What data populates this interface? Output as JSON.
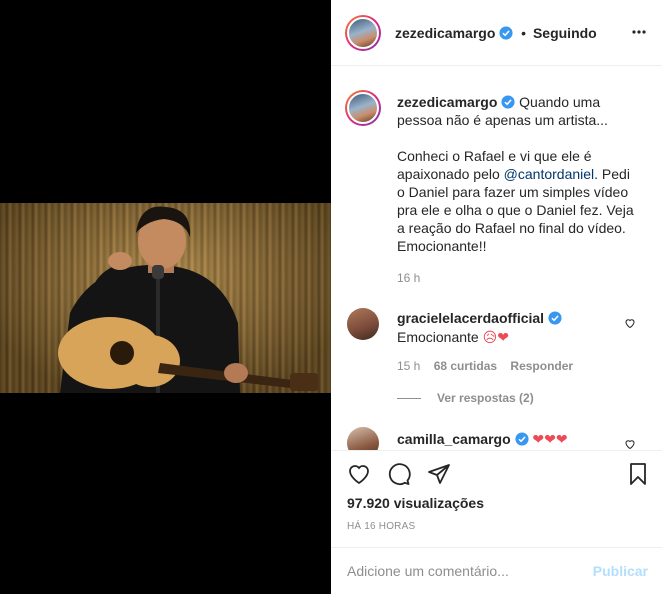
{
  "post": {
    "username": "zezedicamargo",
    "dot": "•",
    "follow_status": "Seguindo",
    "more_icon": "more-horizontal-icon"
  },
  "caption": {
    "username": "zezedicamargo",
    "line1": "Quando uma pessoa não é apenas um artista...",
    "para_a": "Conheci o Rafael e vi que ele é apaixonado pelo ",
    "mention": "@cantordaniel",
    "para_b": ". Pedi o Daniel para fazer um simples vídeo pra ele e olha o que o Daniel fez. Veja a reação do Rafael no final do vídeo. Emocionante!!",
    "time": "16 h"
  },
  "comments": [
    {
      "username": "gracielelacerdaofficial",
      "text": "Emocionante",
      "emojis": "😥❤",
      "time": "15 h",
      "likes": "68 curtidas",
      "reply": "Responder",
      "replies_toggle": "Ver respostas (2)"
    },
    {
      "username": "camilla_camargo",
      "emojis": "❤❤❤"
    }
  ],
  "actions": {
    "like_icon": "heart-icon",
    "comment_icon": "comment-icon",
    "share_icon": "paper-plane-icon",
    "save_icon": "bookmark-icon",
    "views": "97.920 visualizações",
    "timestamp": "HÁ 16 HORAS"
  },
  "add_comment": {
    "placeholder": "Adicione um comentário...",
    "publish": "Publicar"
  },
  "colors": {
    "verified": "#3897f0",
    "link": "#00376b",
    "heart": "#ed4956",
    "muted": "#8e8e8e",
    "publish_disabled": "#b2dffc"
  }
}
